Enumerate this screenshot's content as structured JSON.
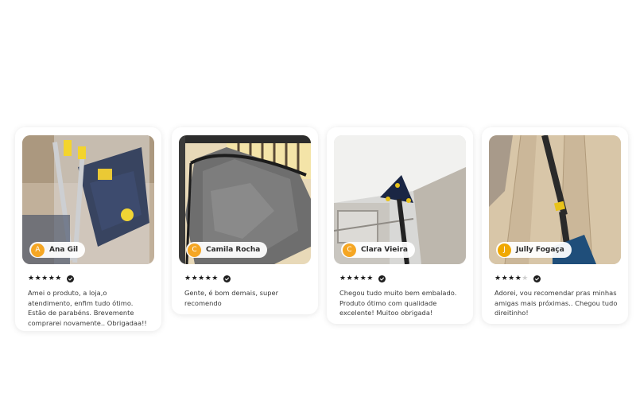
{
  "reviews": [
    {
      "author": "Ana Gil",
      "avatar_letter": "A",
      "rating": 5,
      "stars_on": "★★★★★",
      "stars_off": "",
      "verified_icon": "check-badge-icon",
      "text": "Amei o produto, a loja,o atendimento, enfim tudo ótimo. Estão de parabéns. Brevemente comprarei novamente.. Obrigadaa!!"
    },
    {
      "author": "Camila Rocha",
      "avatar_letter": "C",
      "rating": 5,
      "stars_on": "★★★★★",
      "stars_off": "",
      "verified_icon": "check-badge-icon",
      "text": "Gente, é bom demais, super recomendo"
    },
    {
      "author": "Clara Vieira",
      "avatar_letter": "C",
      "rating": 5,
      "stars_on": "★★★★★",
      "stars_off": "",
      "verified_icon": "check-badge-icon",
      "text": "Chegou tudo muito bem embalado. Produto ótimo com qualidade excelente! Muitoo obrigada!"
    },
    {
      "author": "Jully Fogaça",
      "avatar_letter": "J",
      "rating": 4,
      "stars_on": "★★★★",
      "stars_off": "★",
      "verified_icon": "check-badge-icon",
      "text": "Adorei, vou recomendar pras minhas amigas mais próximas.. Chegou tudo direitinho!"
    }
  ],
  "colors": {
    "avatar": "#f5a623",
    "star": "#1b1b1b",
    "star_off": "#cfcfcf",
    "text": "#3a3a3a"
  }
}
